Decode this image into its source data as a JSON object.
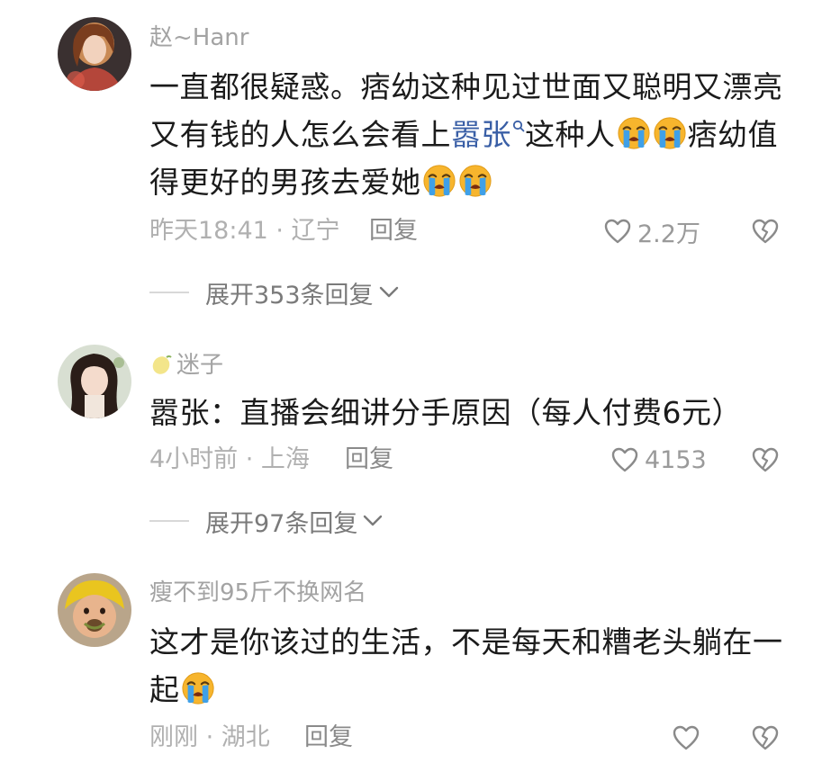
{
  "comments": [
    {
      "username": "赵~Hanr",
      "text": {
        "part1": "一直都很疑惑。痞幼这种见过世面又聪明又漂亮又有钱的人怎么会看上",
        "mention": "嚣张",
        "part2": "这种人",
        "part3": "痞幼值得更好的男孩去爱她"
      },
      "time_location": "昨天18:41 · 辽宁",
      "reply_label": "回复",
      "like_count": "2.2万",
      "expand_label": "展开353条回复"
    },
    {
      "username": "迷子",
      "text": "嚣张：直播会细讲分手原因（每人付费6元）",
      "time_location": "4小时前 · 上海",
      "reply_label": "回复",
      "like_count": "4153",
      "expand_label": "展开97条回复"
    },
    {
      "username": "瘦不到95斤不换网名",
      "text": "这才是你该过的生活，不是每天和糟老头躺在一起",
      "time_location": "刚刚 · 湖北",
      "reply_label": "回复",
      "like_count": ""
    }
  ],
  "colors": {
    "mention": "#3a5fa6",
    "meta": "#b0b0b0",
    "text": "#1b1b1b"
  },
  "icons": [
    "heart-outline-icon",
    "broken-heart-icon",
    "loudly-crying-emoji",
    "search-mention-icon",
    "chevron-down-icon",
    "lemon-badge-icon"
  ]
}
